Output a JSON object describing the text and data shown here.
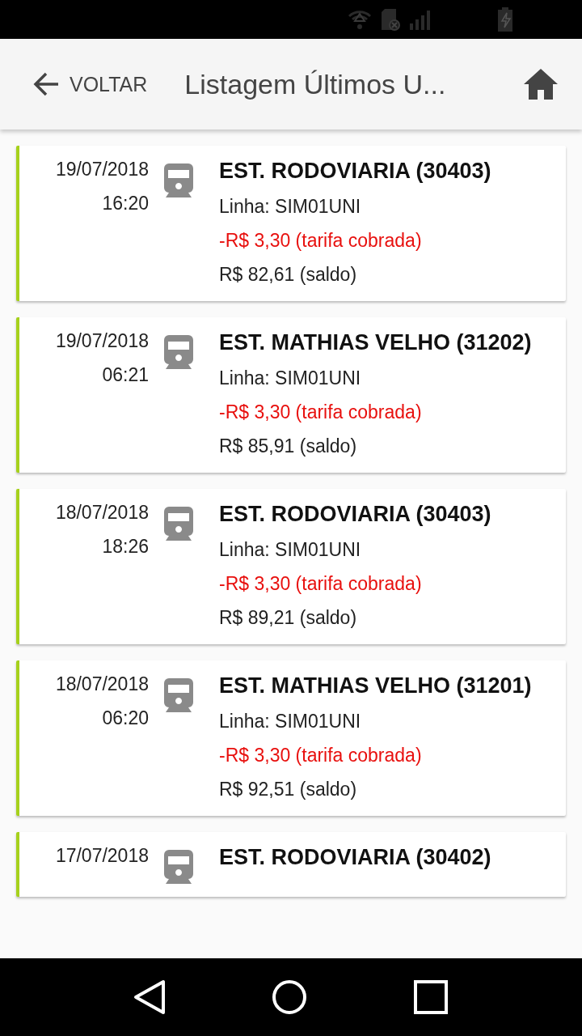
{
  "header": {
    "back_label": "VOLTAR",
    "title": "Listagem Últimos U..."
  },
  "entries": [
    {
      "date": "19/07/2018",
      "time": "16:20",
      "station": "EST. RODOVIARIA (30403)",
      "line": "Linha: SIM01UNI",
      "fare": "-R$ 3,30 (tarifa cobrada)",
      "balance": "R$ 82,61 (saldo)"
    },
    {
      "date": "19/07/2018",
      "time": "06:21",
      "station": "EST. MATHIAS VELHO (31202)",
      "line": "Linha: SIM01UNI",
      "fare": "-R$ 3,30 (tarifa cobrada)",
      "balance": "R$ 85,91 (saldo)"
    },
    {
      "date": "18/07/2018",
      "time": "18:26",
      "station": "EST. RODOVIARIA (30403)",
      "line": "Linha: SIM01UNI",
      "fare": "-R$ 3,30 (tarifa cobrada)",
      "balance": "R$ 89,21 (saldo)"
    },
    {
      "date": "18/07/2018",
      "time": "06:20",
      "station": "EST. MATHIAS VELHO (31201)",
      "line": "Linha: SIM01UNI",
      "fare": "-R$ 3,30 (tarifa cobrada)",
      "balance": "R$ 92,51 (saldo)"
    },
    {
      "date": "17/07/2018",
      "station": "EST. RODOVIARIA (30402)"
    }
  ]
}
